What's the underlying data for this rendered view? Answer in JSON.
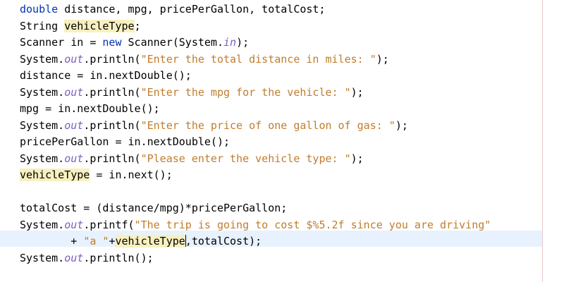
{
  "editor": {
    "lines": [
      {
        "segments": [
          {
            "t": "double",
            "c": "kw"
          },
          {
            "t": " distance, mpg, pricePerGallon, totalCost;"
          }
        ]
      },
      {
        "segments": [
          {
            "t": "String "
          },
          {
            "t": "vehicleType",
            "c": "hl"
          },
          {
            "t": ";"
          }
        ]
      },
      {
        "segments": [
          {
            "t": "Scanner in = "
          },
          {
            "t": "new",
            "c": "kw"
          },
          {
            "t": " Scanner(System."
          },
          {
            "t": "in",
            "c": "field"
          },
          {
            "t": ");"
          }
        ]
      },
      {
        "segments": [
          {
            "t": "System."
          },
          {
            "t": "out",
            "c": "field"
          },
          {
            "t": ".println("
          },
          {
            "t": "\"Enter the total distance in miles: \"",
            "c": "str"
          },
          {
            "t": ");"
          }
        ]
      },
      {
        "segments": [
          {
            "t": "distance = in.nextDouble();"
          }
        ]
      },
      {
        "segments": [
          {
            "t": "System."
          },
          {
            "t": "out",
            "c": "field"
          },
          {
            "t": ".println("
          },
          {
            "t": "\"Enter the mpg for the vehicle: \"",
            "c": "str"
          },
          {
            "t": ");"
          }
        ]
      },
      {
        "segments": [
          {
            "t": "mpg = in.nextDouble();"
          }
        ]
      },
      {
        "segments": [
          {
            "t": "System."
          },
          {
            "t": "out",
            "c": "field"
          },
          {
            "t": ".println("
          },
          {
            "t": "\"Enter the price of one gallon of gas: \"",
            "c": "str"
          },
          {
            "t": ");"
          }
        ]
      },
      {
        "segments": [
          {
            "t": "pricePerGallon = in.nextDouble();"
          }
        ]
      },
      {
        "segments": [
          {
            "t": "System."
          },
          {
            "t": "out",
            "c": "field"
          },
          {
            "t": ".println("
          },
          {
            "t": "\"Please enter the vehicle type: \"",
            "c": "str"
          },
          {
            "t": ");"
          }
        ]
      },
      {
        "segments": [
          {
            "t": "vehicleType",
            "c": "hl"
          },
          {
            "t": " = in.next();"
          }
        ]
      },
      {
        "segments": []
      },
      {
        "segments": [
          {
            "t": "totalCost = (distance/mpg)*pricePerGallon;"
          }
        ]
      },
      {
        "segments": [
          {
            "t": "System."
          },
          {
            "t": "out",
            "c": "field"
          },
          {
            "t": ".printf("
          },
          {
            "t": "\"The trip is going to cost $%5.2f since you are driving\"",
            "c": "str"
          }
        ]
      },
      {
        "segments": [
          {
            "t": "        + "
          },
          {
            "t": "\"a \"",
            "c": "str"
          },
          {
            "t": "+"
          },
          {
            "t": "vehicleType",
            "c": "hl"
          },
          {
            "t": "",
            "c": "caret"
          },
          {
            "t": ",totalCost);"
          }
        ]
      },
      {
        "segments": [
          {
            "t": "System."
          },
          {
            "t": "out",
            "c": "field"
          },
          {
            "t": ".println();"
          }
        ]
      }
    ]
  },
  "colors": {
    "keyword": "#0033b3",
    "string": "#c07d2d",
    "static_field": "#7a5fc0",
    "identifier_highlight": "#f7f0c0",
    "current_line": "#e8f2fe",
    "right_margin": "#e6c8c8"
  }
}
